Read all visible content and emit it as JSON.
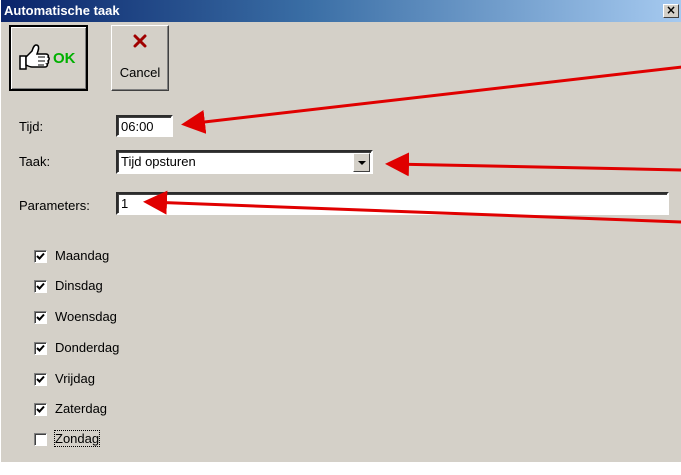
{
  "window": {
    "title": "Automatische taak",
    "close_glyph": "×"
  },
  "toolbar": {
    "ok_label": "OK",
    "ok_icon": "thumbs-up-icon",
    "cancel_label": "Cancel",
    "cancel_icon": "red-x-icon"
  },
  "form": {
    "tijd_label": "Tijd:",
    "tijd_value": "06:00",
    "taak_label": "Taak:",
    "taak_value": "Tijd opsturen",
    "parameters_label": "Parameters:",
    "parameters_value": "1"
  },
  "days": [
    {
      "label": "Maandag",
      "checked": true
    },
    {
      "label": "Dinsdag",
      "checked": true
    },
    {
      "label": "Woensdag",
      "checked": true
    },
    {
      "label": "Donderdag",
      "checked": true
    },
    {
      "label": "Vrijdag",
      "checked": true
    },
    {
      "label": "Zaterdag",
      "checked": true
    },
    {
      "label": "Zondag",
      "checked": false
    }
  ],
  "colors": {
    "dialog_bg": "#d4d0c8",
    "titlebar_start": "#0a246a",
    "annotation_arrow": "#e00000",
    "ok_green": "#00b000"
  }
}
